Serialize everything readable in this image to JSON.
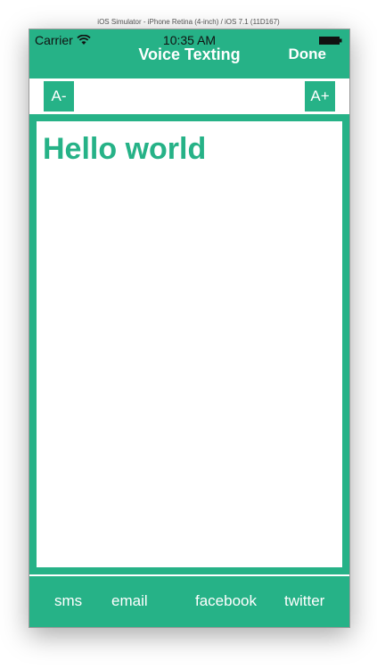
{
  "simulator": {
    "title": "iOS Simulator - iPhone Retina (4-inch) / iOS 7.1 (11D167)"
  },
  "status_bar": {
    "carrier": "Carrier",
    "time": "10:35 AM",
    "wifi_icon": "wifi-icon",
    "battery_icon": "battery-icon"
  },
  "nav": {
    "title": "Voice Texting",
    "done_label": "Done"
  },
  "toolbar": {
    "decrease_label": "A-",
    "increase_label": "A+"
  },
  "editor": {
    "text": "Hello world"
  },
  "share": {
    "items": [
      {
        "label": "sms"
      },
      {
        "label": "email"
      },
      {
        "label": "facebook"
      },
      {
        "label": "twitter"
      }
    ]
  },
  "colors": {
    "accent": "#26b287",
    "background": "#ffffff"
  }
}
